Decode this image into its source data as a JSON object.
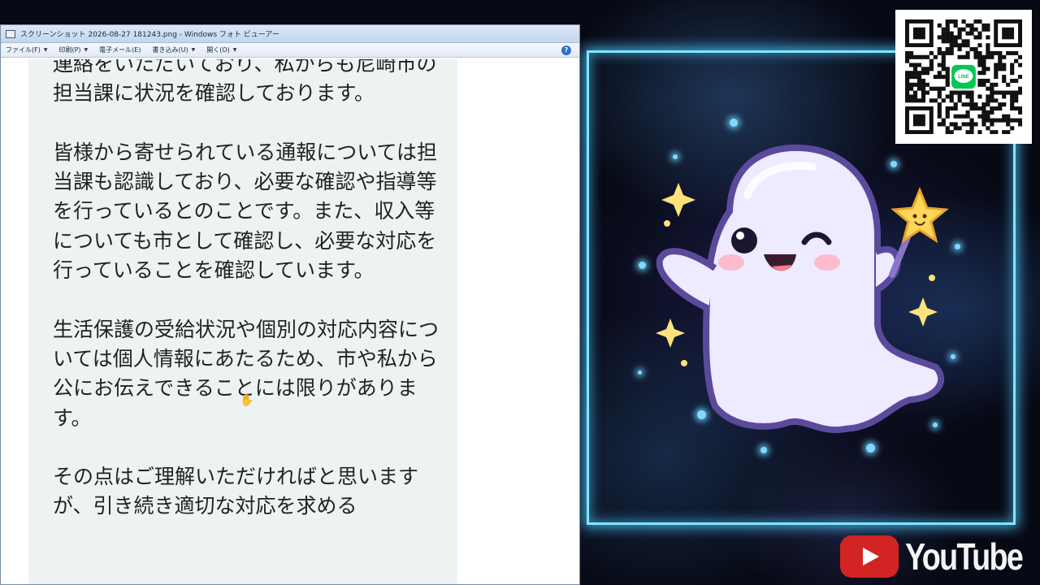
{
  "window": {
    "title": "スクリーンショット 2026-08-27 181243.png - Windows フォト ビューアー",
    "menu": [
      {
        "label": "ファイル(F)"
      },
      {
        "label": "印刷(P)"
      },
      {
        "label": "電子メール(E)"
      },
      {
        "label": "書き込み(U)"
      },
      {
        "label": "開く(O)"
      }
    ],
    "help_label": "?"
  },
  "document": {
    "paragraphs": [
      "連絡をいただいており、私からも尼崎市の担当課に状況を確認しております。",
      "皆様から寄せられている通報については担当課も認識しており、必要な確認や指導等を行っているとのことです。また、収入等についても市として確認し、必要な対応を行っていることを確認しています。",
      "生活保護の受給状況や個別の対応内容については個人情報にあたるため、市や私から公にお伝えできることには限りがあります。",
      "その点はご理解いただければと思いますが、引き続き適切な対応を求める"
    ]
  },
  "overlay": {
    "qr_badge": "LINE",
    "youtube_label": "YouTube",
    "accent_color": "#7fe7ff",
    "youtube_color": "#d32424"
  },
  "icons": [
    "app-icon",
    "help-icon",
    "hand-cursor-icon",
    "qr-code-icon",
    "line-logo-icon",
    "youtube-play-icon",
    "star-wand-icon"
  ]
}
